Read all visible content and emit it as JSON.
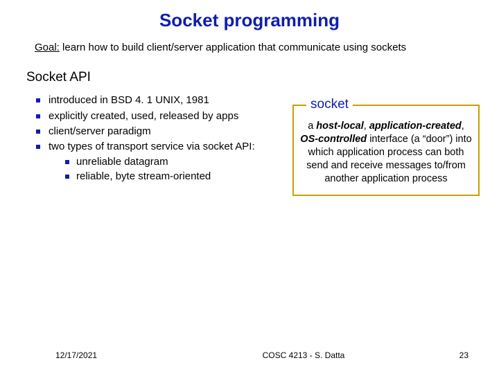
{
  "title": "Socket programming",
  "goal": {
    "label": "Goal:",
    "text": " learn how to build client/server application that communicate using sockets"
  },
  "section_heading": "Socket API",
  "bullets": {
    "b0": "introduced in BSD 4. 1 UNIX, 1981",
    "b1": "explicitly created, used, released by apps",
    "b2": "client/server paradigm",
    "b3": "two types of transport service via socket API:",
    "sub0": "unreliable datagram",
    "sub1": "reliable, byte stream-oriented"
  },
  "socket": {
    "legend": "socket",
    "line1_a": "a ",
    "line1_b": "host-local",
    "line1_c": ", ",
    "line2_a": "application-created",
    "line2_b": ", ",
    "line3_a": "OS-controlled",
    "line3_b": " interface (a “door”) into which application process can both send and receive messages to/from another application process"
  },
  "footer": {
    "date": "12/17/2021",
    "center": "COSC 4213 - S. Datta",
    "pageno": "23"
  }
}
